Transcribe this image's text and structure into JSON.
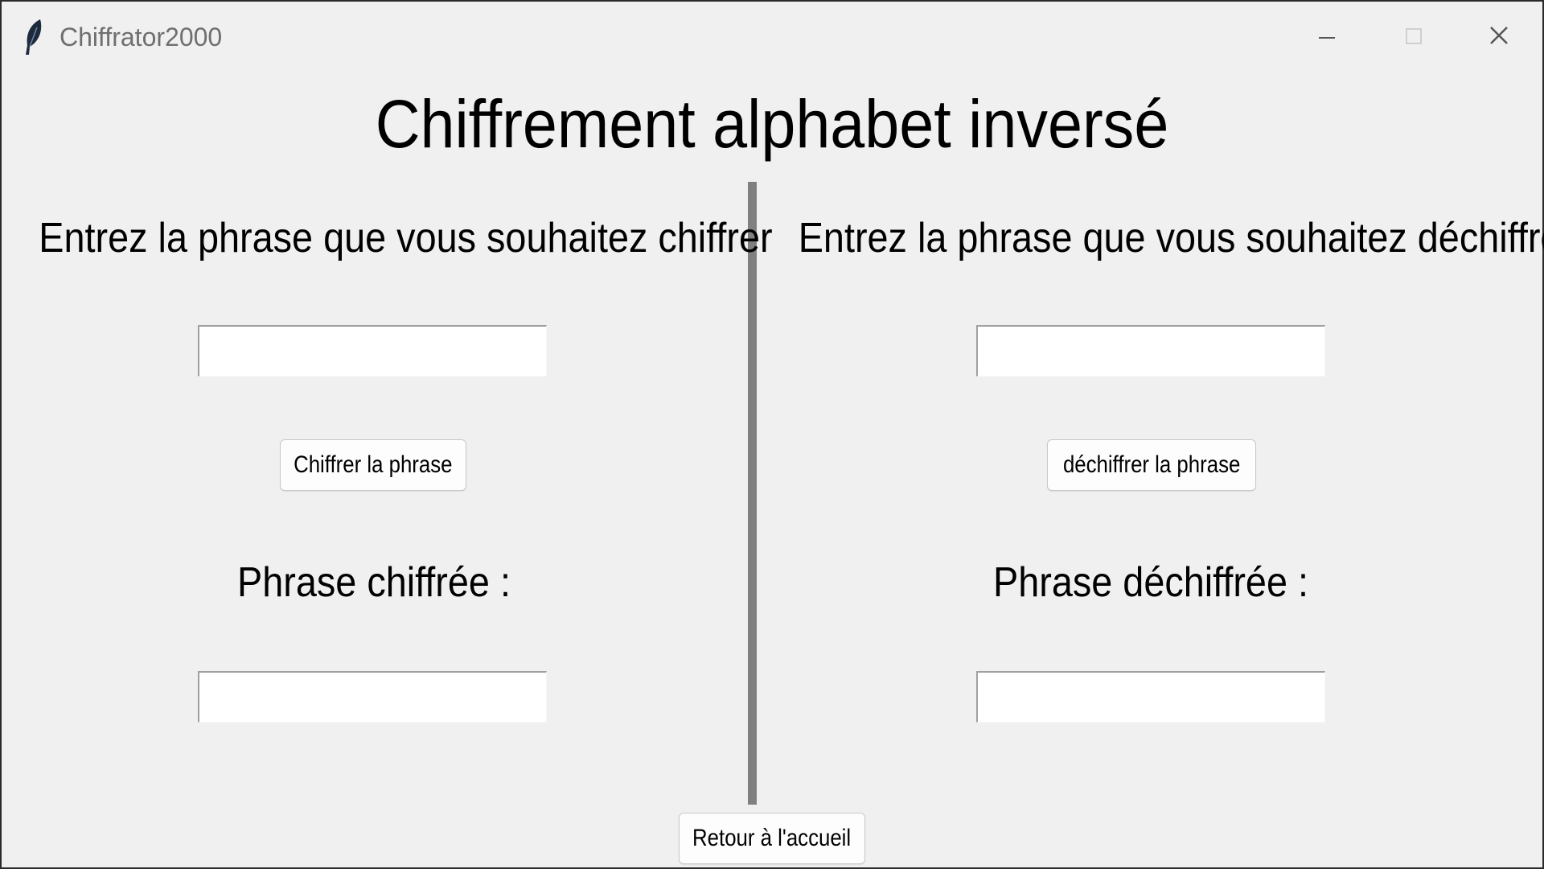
{
  "window": {
    "title": "Chiffrator2000",
    "icon": "feather-icon",
    "controls": [
      "minimize-icon",
      "maximize-icon",
      "close-icon"
    ]
  },
  "heading": "Chiffrement alphabet inversé",
  "encrypt_panel": {
    "prompt": "Entrez la phrase que vous souhaitez chiffrer",
    "input_value": "",
    "button_label": "Chiffrer la phrase",
    "result_label": "Phrase chiffrée :",
    "output_value": ""
  },
  "decrypt_panel": {
    "prompt": "Entrez la phrase que vous souhaitez déchiffrer",
    "input_value": "",
    "button_label": "déchiffrer la phrase",
    "result_label": "Phrase déchiffrée :",
    "output_value": ""
  },
  "footer": {
    "home_button_label": "Retour à l'accueil"
  },
  "colors": {
    "background": "#f0f0f0",
    "divider": "#808080",
    "title_text": "#6f6f6f"
  }
}
